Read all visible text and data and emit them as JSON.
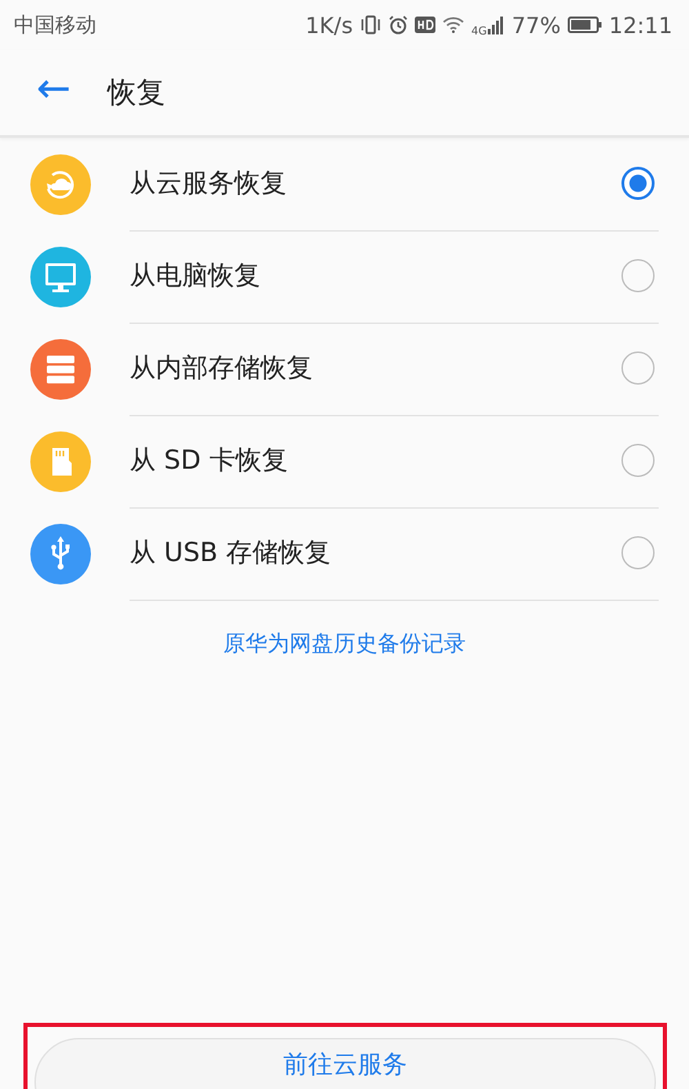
{
  "status_bar": {
    "carrier": "中国移动",
    "speed": "1K/s",
    "network": "4G",
    "battery_text": "77%",
    "time": "12:11"
  },
  "header": {
    "back": "←",
    "title": "恢复"
  },
  "options": [
    {
      "kind": "cloud",
      "label": "从云服务恢复",
      "color": "#fbbc2c",
      "selected": true
    },
    {
      "kind": "computer",
      "label": "从电脑恢复",
      "color": "#1fb5e0",
      "selected": false
    },
    {
      "kind": "storage",
      "label": "从内部存储恢复",
      "color": "#f56d3b",
      "selected": false
    },
    {
      "kind": "sdcard",
      "label": "从 SD 卡恢复",
      "color": "#fbbc2c",
      "selected": false
    },
    {
      "kind": "usb",
      "label": "从 USB 存储恢复",
      "color": "#3a97f5",
      "selected": false
    }
  ],
  "history_link": "原华为网盘历史备份记录",
  "primary_button": {
    "label": "前往云服务",
    "highlighted": true
  }
}
